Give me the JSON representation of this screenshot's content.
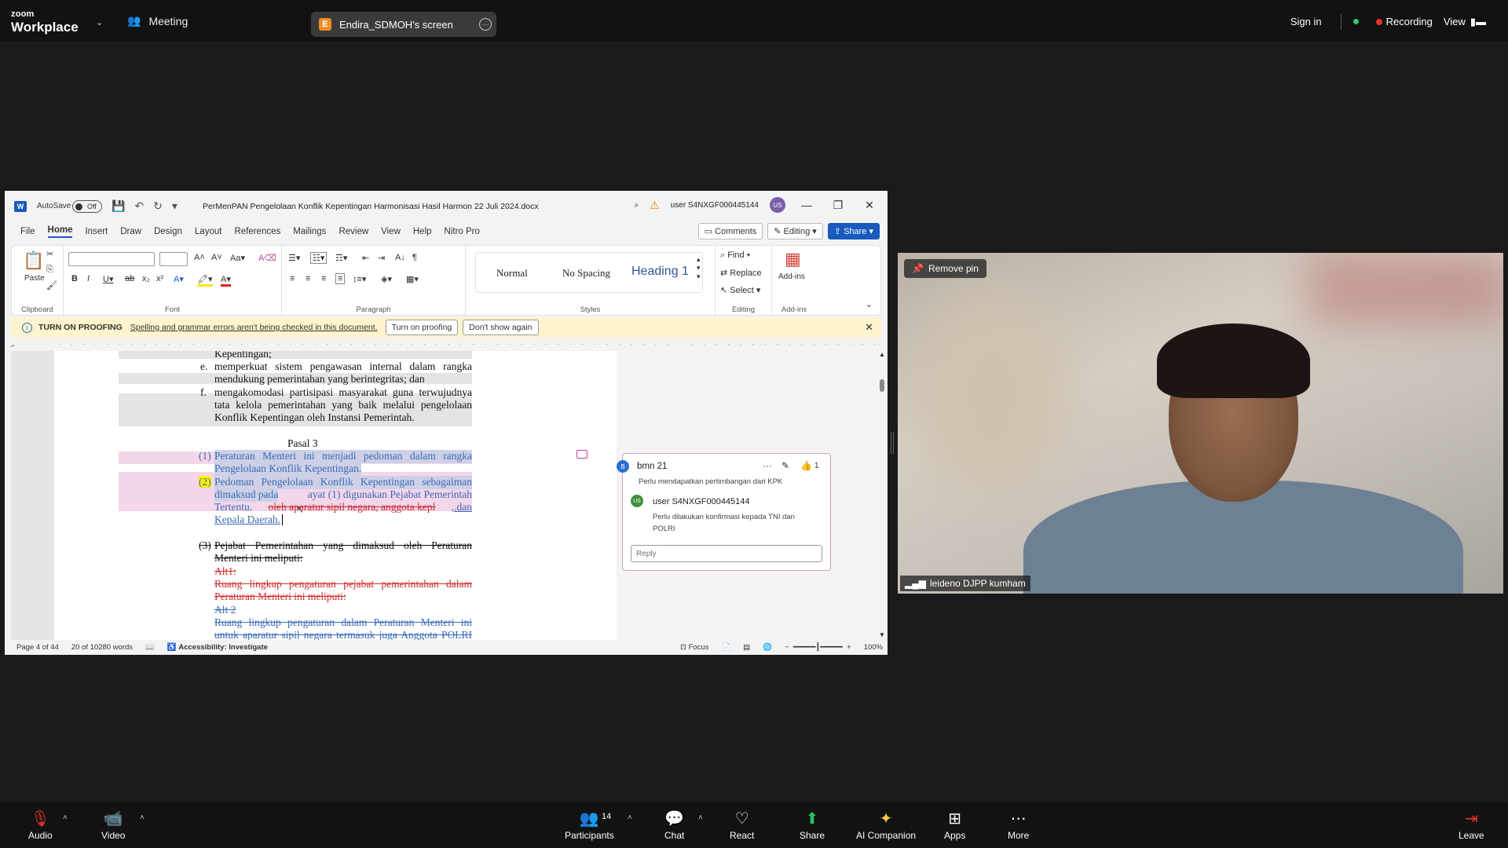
{
  "zoom": {
    "logo_top": "zoom",
    "logo_bottom": "Workplace",
    "meeting_label": "Meeting",
    "screen_share": {
      "initial": "E",
      "label": "Endira_SDMOH's screen"
    },
    "sign_in": "Sign in",
    "recording": "Recording",
    "view": "View",
    "toolbar": {
      "audio": "Audio",
      "video": "Video",
      "participants": "Participants",
      "participants_count": "14",
      "chat": "Chat",
      "react": "React",
      "share": "Share",
      "ai_companion": "AI Companion",
      "apps": "Apps",
      "more": "More",
      "leave": "Leave"
    },
    "video_tile": {
      "remove_pin": "Remove pin",
      "name": "leideno DJPP kumham"
    }
  },
  "word": {
    "autosave": "AutoSave",
    "autosave_state": "Off",
    "doc_title": "PerMenPAN Pengelolaan Konflik Kepentingan Harmonisasi Hasil Harmon 22 Juli 2024.docx",
    "user": "user S4NXGF000445144",
    "user_initials": "US",
    "menu": [
      "File",
      "Home",
      "Insert",
      "Draw",
      "Design",
      "Layout",
      "References",
      "Mailings",
      "Review",
      "View",
      "Help",
      "Nitro Pro"
    ],
    "comments_btn": "Comments",
    "editing_btn": "Editing",
    "share_btn": "Share",
    "ribbon": {
      "paste": "Paste",
      "clipboard": "Clipboard",
      "font": "Font",
      "paragraph": "Paragraph",
      "styles": "Styles",
      "editing": "Editing",
      "addins_group": "Add-ins",
      "addins": "Add-ins",
      "style_normal": "Normal",
      "style_nospacing": "No Spacing",
      "style_heading1": "Heading 1",
      "find": "Find",
      "replace": "Replace",
      "select": "Select"
    },
    "proofing": {
      "title": "TURN ON PROOFING",
      "message": "Spelling and grammar errors aren't being checked in this document.",
      "turn_on": "Turn on proofing",
      "dont_show": "Don't show again"
    },
    "doc": {
      "line0": "Kepentingan;",
      "e_label": "e.",
      "e_l1": "memperkuat sistem pengawasan internal dalam rangka",
      "e_l2": "mendukung pemerintahan yang berintegritas; dan",
      "f_label": "f.",
      "f_l1": "mengakomodasi partisipasi masyarakat guna terwujudnya",
      "f_l2": "tata kelola pemerintahan yang baik melalui pengelolaan",
      "f_l3": "Konflik Kepentingan oleh Instansi Pemerintah.",
      "pasal": "Pasal 3",
      "p1_label": "(1)",
      "p1_l1": "Peraturan Menteri ini menjadi pedoman dalam rangka",
      "p1_l2": "Pengelolaan Konflik Kepentingan.",
      "p2_label": "(2)",
      "p2_l1": "Pedoman Pengelolaan Konflik Kepentingan sebagaiman",
      "p2_l2a": "dimaksud pada",
      "p2_l2b": "ayat (1) digunakan Pejabat Pemerintah",
      "p2_l3a": "Tertentu.",
      "p2_l3b": "oleh aparatur sipil negara, anggota kepl",
      "p2_l3c": ",.dan",
      "p2_l4": "Kepala Daerah.",
      "p3_label": "(3)",
      "p3_l1": "Pejabat Pemerintahan yang dimaksud oleh Peraturan",
      "p3_l2": "Menteri ini meliputi:",
      "alt1": "Alt1:",
      "r1": "Ruang lingkup pengaturan pejabat pemerintahan dalam",
      "r2": "Peraturan Menteri ini meliputi:",
      "alt2": "Alt 2",
      "b1": "Ruang lingkup pengaturan dalam Peraturan Menteri ini",
      "b2": "untuk aparatur sipil negara termasuk juga Anggota POLRI"
    },
    "comment": {
      "author": "bmn 21",
      "author_initial": "B",
      "likes": "1",
      "text": "Perlu mendapatkan pertimbangan dari KPK",
      "reply_author": "user S4NXGF000445144",
      "reply_initials": "US",
      "reply_text_1": "Perlu dilakukan konfirmasi kepada TNI dan",
      "reply_text_2": "POLRI",
      "reply_placeholder": "Reply"
    },
    "status": {
      "page": "Page 4 of 44",
      "words": "20 of 10280 words",
      "accessibility": "Accessibility: Investigate",
      "focus": "Focus",
      "zoom": "100%"
    }
  },
  "colors": {
    "word_blue": "#185abd",
    "rec_red": "#e5312d",
    "share_green": "#22c55e"
  }
}
